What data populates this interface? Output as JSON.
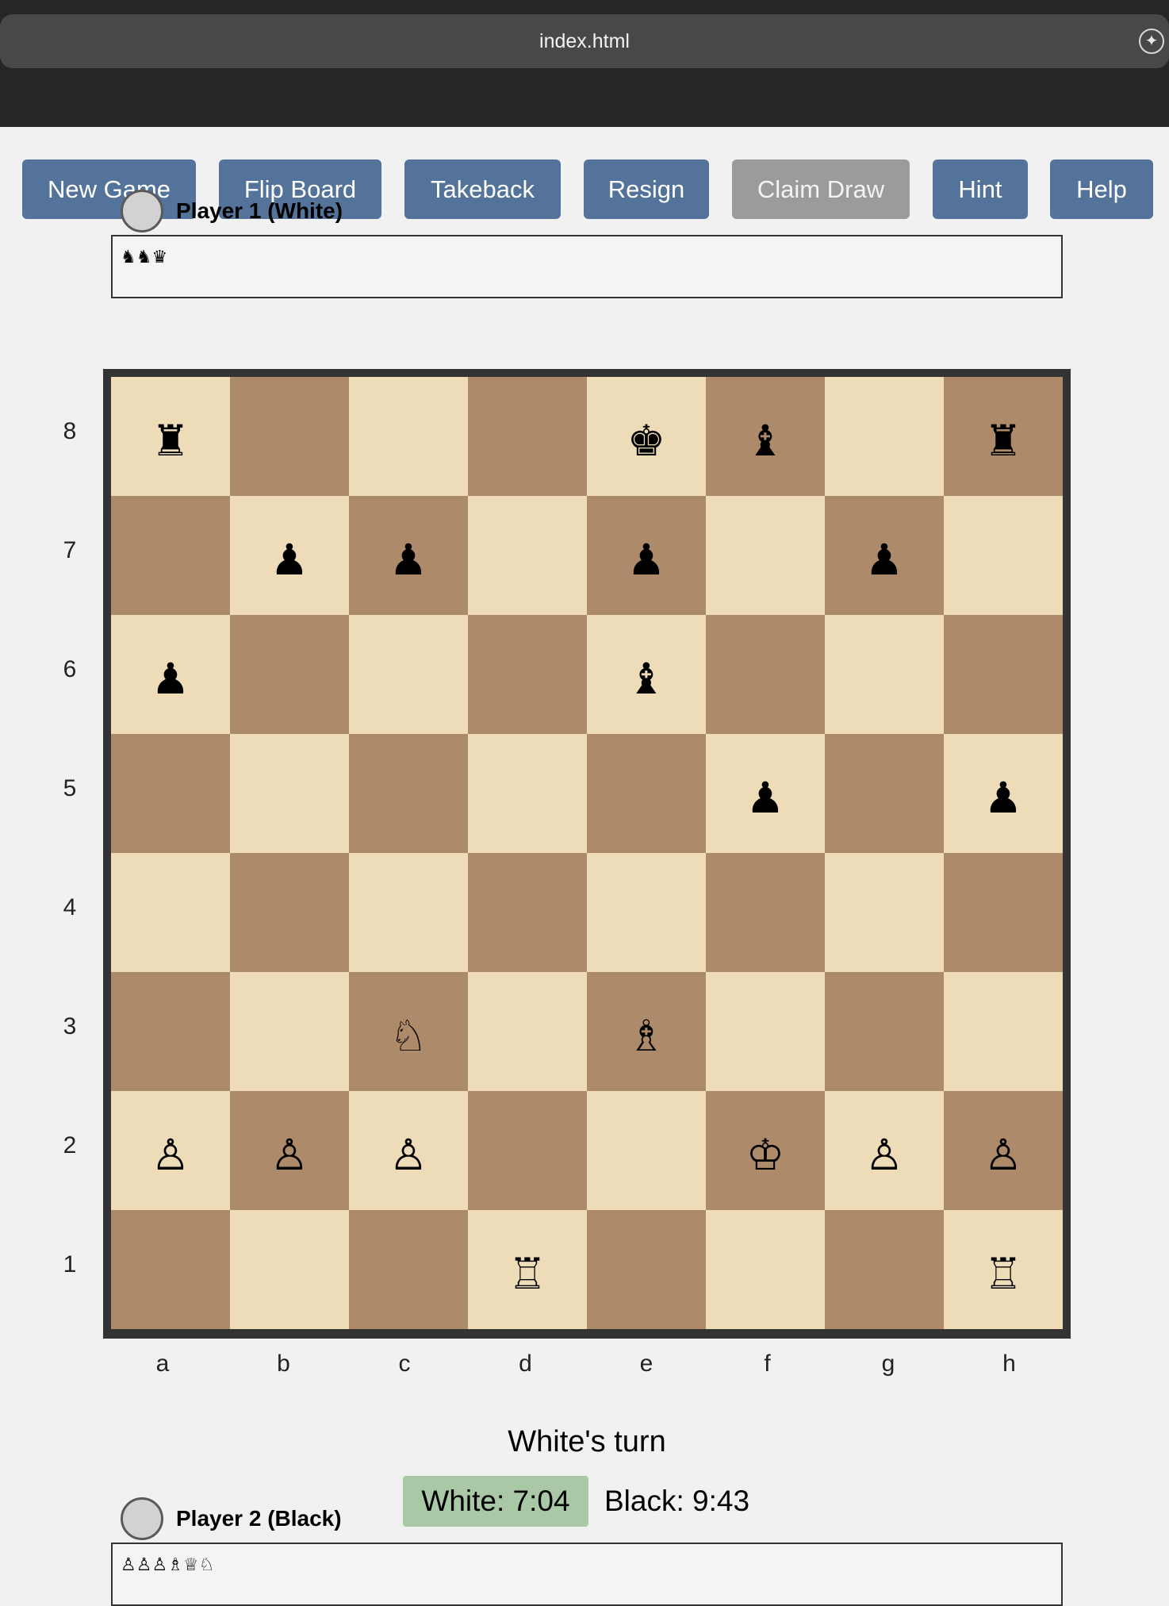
{
  "browser": {
    "address": "index.html",
    "assist_icon": "sparkle-icon"
  },
  "toolbar": {
    "new_game": "New Game",
    "flip_board": "Flip Board",
    "takeback": "Takeback",
    "resign": "Resign",
    "claim_draw": "Claim Draw",
    "hint": "Hint",
    "help": "Help"
  },
  "player1": {
    "name": "Player 1 (White)",
    "captured": "♞♞♛"
  },
  "player2": {
    "name": "Player 2 (Black)",
    "captured": "♙♙♙♗♕♘"
  },
  "board": {
    "ranks": [
      "8",
      "7",
      "6",
      "5",
      "4",
      "3",
      "2",
      "1"
    ],
    "files": [
      "a",
      "b",
      "c",
      "d",
      "e",
      "f",
      "g",
      "h"
    ],
    "rows": [
      [
        "♜",
        "",
        "",
        "",
        "♚",
        "♝",
        "",
        "♜"
      ],
      [
        "",
        "♟",
        "♟",
        "",
        "♟",
        "",
        "♟",
        ""
      ],
      [
        "♟",
        "",
        "",
        "",
        "♝",
        "",
        "",
        ""
      ],
      [
        "",
        "",
        "",
        "",
        "",
        "♟",
        "",
        "♟"
      ],
      [
        "",
        "",
        "",
        "",
        "",
        "",
        "",
        ""
      ],
      [
        "",
        "",
        "♘",
        "",
        "♗",
        "",
        "",
        ""
      ],
      [
        "♙",
        "♙",
        "♙",
        "",
        "",
        "♔",
        "♙",
        "♙"
      ],
      [
        "",
        "",
        "",
        "♖",
        "",
        "",
        "",
        "♖"
      ]
    ],
    "light_color": "#eedbb7",
    "dark_color": "#ad8a69"
  },
  "status": {
    "turn": "White's turn"
  },
  "clocks": {
    "white": "White: 7:04",
    "black": "Black: 9:43"
  }
}
